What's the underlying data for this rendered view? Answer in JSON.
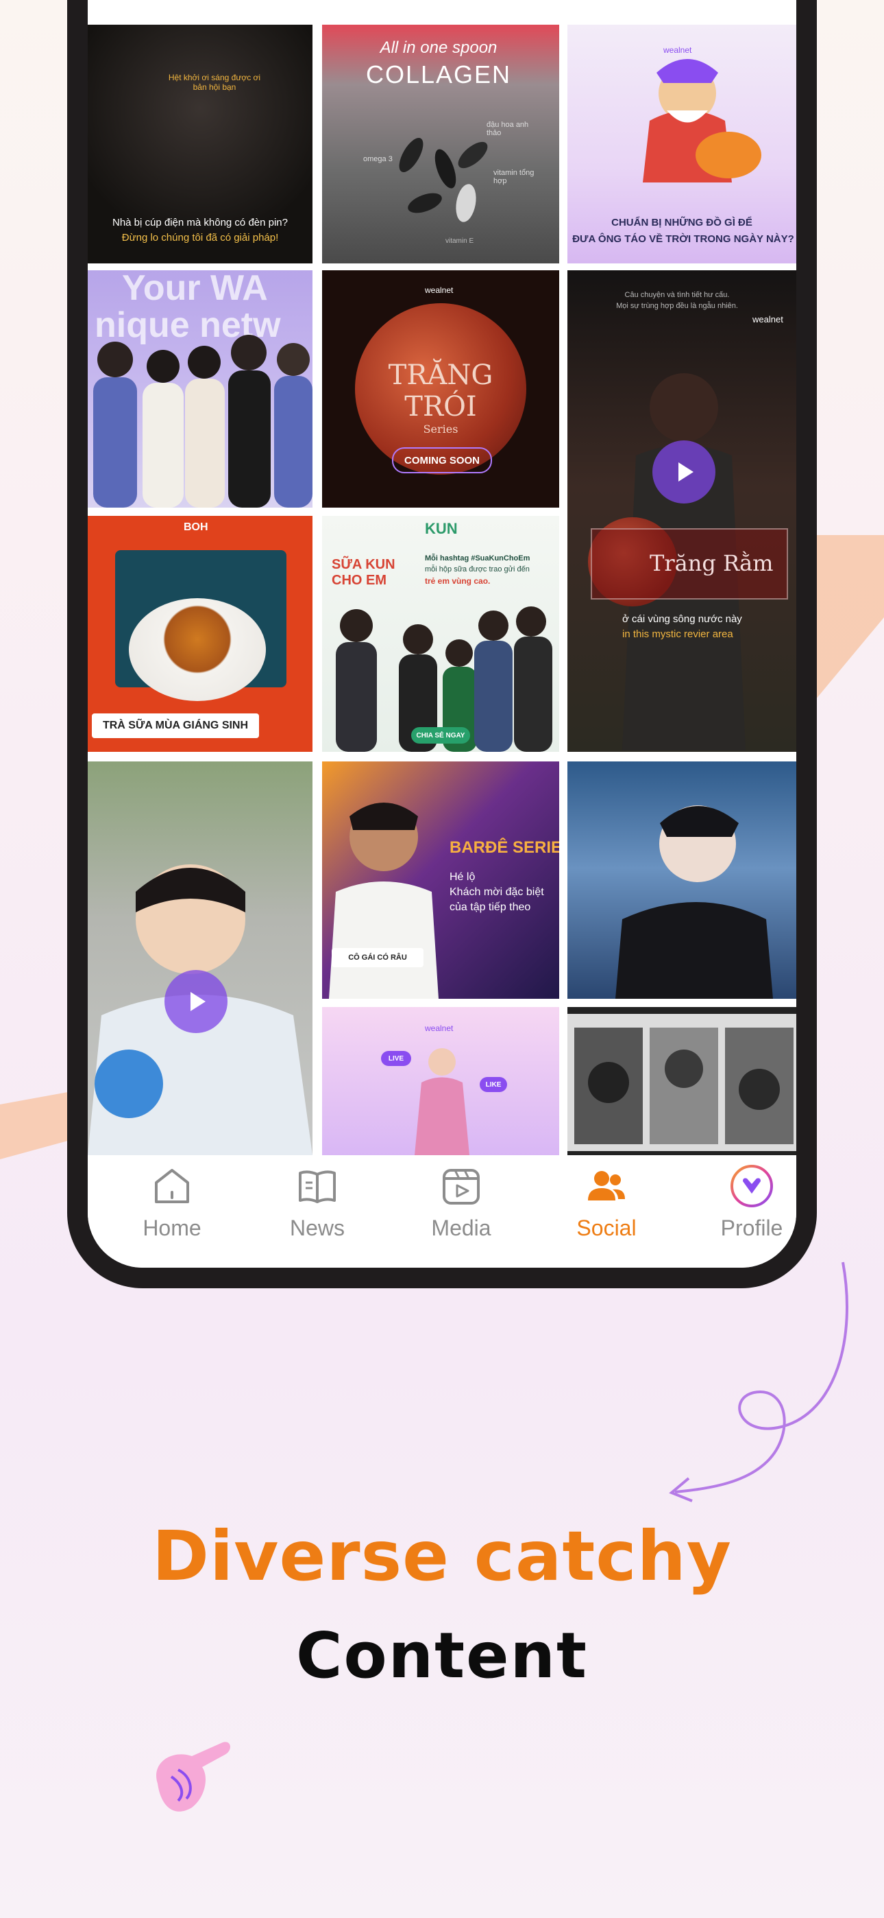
{
  "colors": {
    "accent": "#ee7d14",
    "brand_purple": "#8a4df0",
    "inactive": "#8c8c8c"
  },
  "tiles": [
    {
      "texts": [
        "Hệt khởi ơi sáng được ơi bản hội bạn",
        "Nhà bị cúp điện mà không có đèn pin?",
        "Đừng lo chúng tôi đã có giải pháp!"
      ]
    },
    {
      "texts": [
        "All in one spoon",
        "COLLAGEN",
        "omega 3",
        "đậu hoa anh thảo",
        "vitamin tổng hợp",
        "vitamin E"
      ]
    },
    {
      "texts": [
        "wealnet",
        "CHUẨN BỊ NHỮNG ĐỒ GÌ ĐỂ",
        "ĐƯA ÔNG TÁO VỀ TRỜI TRONG NGÀY NÀY?"
      ]
    },
    {
      "texts": [
        "Your WA",
        "nique netw"
      ]
    },
    {
      "texts": [
        "wealnet",
        "TRĂNG TRÓI",
        "Series",
        "COMING SOON"
      ]
    },
    {
      "texts": [
        "Câu chuyện và tình tiết hư cấu.",
        "Mọi sự trùng hợp đều là ngẫu nhiên.",
        "wealnet",
        "Trăng Rằm",
        "ở cái vùng sông nước này",
        "in this mystic revier area"
      ]
    },
    {
      "texts": [
        "BOH",
        "TRÀ SỮA MÙA GIÁNG SINH"
      ]
    },
    {
      "texts": [
        "KUN",
        "SỮA KUN CHO EM",
        "Mỗi hashtag #SuaKunChoEm",
        "mỗi hộp sữa được trao gửi đến",
        "trẻ em vùng cao.",
        "CHIA SẺ NGAY"
      ]
    },
    {
      "texts": []
    },
    {
      "texts": [
        "BARĐÊ SERIE",
        "Hé lộ",
        "Khách mời đặc biệt",
        "của tập tiếp theo",
        "CÔ GÁI CÓ RÂU"
      ]
    },
    {
      "texts": []
    },
    {
      "texts": [
        "wealnet",
        "LIVE",
        "LIKE"
      ]
    },
    {
      "texts": []
    }
  ],
  "tabbar": {
    "tabs": [
      {
        "label": "Home",
        "icon": "home-icon"
      },
      {
        "label": "News",
        "icon": "news-icon"
      },
      {
        "label": "Media",
        "icon": "media-icon"
      },
      {
        "label": "Social",
        "icon": "social-icon"
      },
      {
        "label": "Profile",
        "icon": "profile-icon"
      }
    ],
    "active_tab": "Social"
  },
  "headline": {
    "line1": "Diverse catchy",
    "line2": "Content"
  }
}
